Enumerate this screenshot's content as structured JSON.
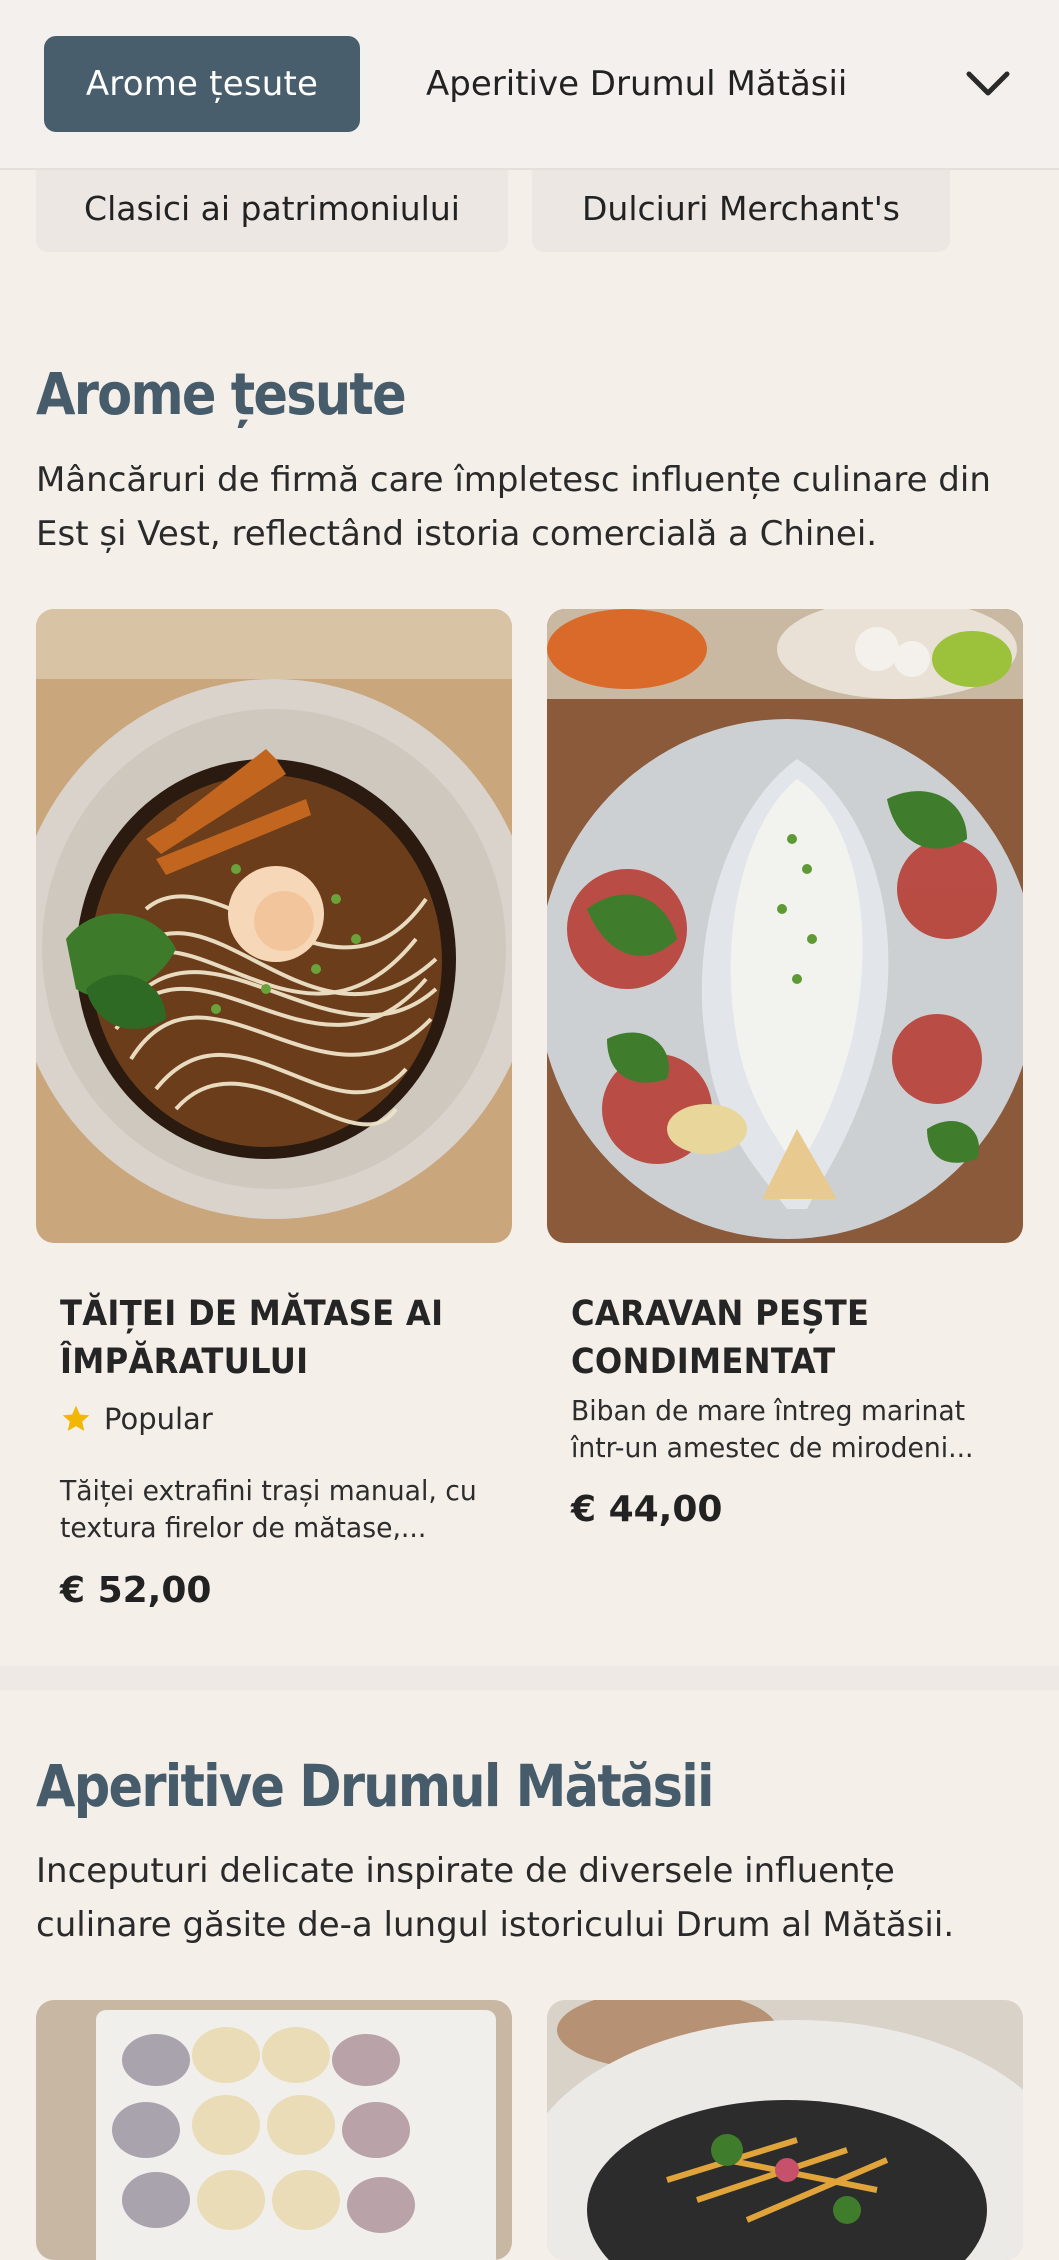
{
  "nav": {
    "active_tab": "Arome țesute",
    "next_tab": "Aperitive Drumul Mătăsii",
    "second_row": [
      "Clasici ai patrimoniului",
      "Dulciuri Merchant's"
    ],
    "toggle_icon": "chevron-down-icon"
  },
  "sections": [
    {
      "title": "Arome țesute",
      "description": "Mâncăruri de firmă care împletesc influențe culinare din Est și Vest, reflectând istoria comercială a Chinei.",
      "items": [
        {
          "name": "TĂIȚEI DE MĂTASE AI ÎMPĂRATULUI",
          "badge": "Popular",
          "description": "Tăiței extrafini trași manual, cu textura firelor de mătase,...",
          "price": "€ 52,00",
          "image": "bowl-of-noodles-with-egg-and-shrimp"
        },
        {
          "name": "CARAVAN PEȘTE CONDIMENTAT",
          "description": "Biban de mare întreg marinat într-un amestec de mirodeni...",
          "price": "€ 44,00",
          "image": "whole-spiced-fish-on-platter"
        }
      ]
    },
    {
      "title": "Aperitive Drumul Mătăsii",
      "description": "Inceputuri delicate inspirate de diversele influențe culinare găsite de-a lungul istoricului Drum al Mătăsii.",
      "items": [
        {
          "image": "dumplings-platter"
        },
        {
          "image": "salad-with-crispy-noodles"
        }
      ]
    }
  ],
  "colors": {
    "accent": "#485e6c",
    "heading": "#475c6a",
    "background": "#f5efea",
    "star": "#f2b705"
  }
}
